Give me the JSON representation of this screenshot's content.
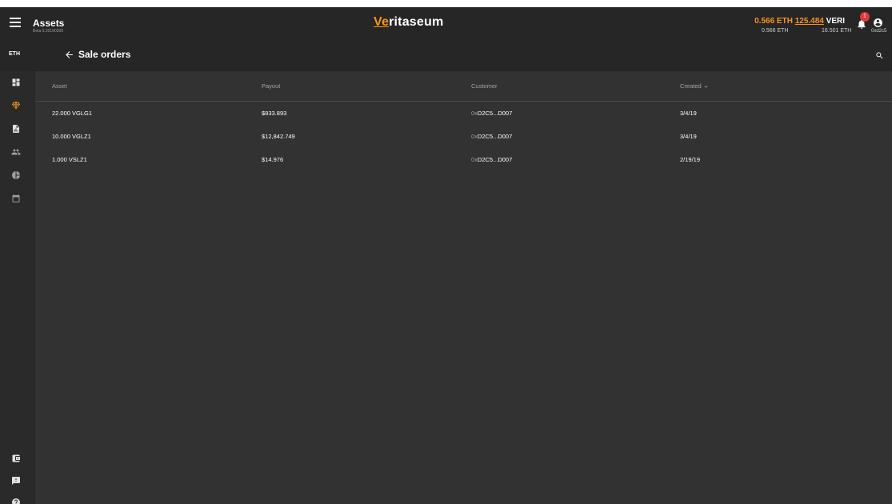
{
  "header": {
    "title": "Assets",
    "version": "Beta 9.20190308",
    "brand_prefix": "Ve",
    "brand_suffix": "ritaseum",
    "balance_eth": "0.566 ETH",
    "balance_veri_value": "125.484",
    "balance_veri_unit": "VERI",
    "sub_eth": "0.566 ETH",
    "sub_veri_eth": "16.501 ETH",
    "notifications_count": "1",
    "account_address": "0xd2c5"
  },
  "subheader": {
    "network": "ETH",
    "page_title": "Sale orders"
  },
  "table": {
    "columns": [
      "Asset",
      "Payout",
      "Customer",
      "Created"
    ],
    "rows": [
      {
        "asset": "22.000 VGLG1",
        "payout": "$833.893",
        "customer_prefix": "0x",
        "customer": "D2C5...D007",
        "created": "3/4/19"
      },
      {
        "asset": "10.000 VGLZ1",
        "payout": "$12,842.749",
        "customer_prefix": "0x",
        "customer": "D2C5...D007",
        "created": "3/4/19"
      },
      {
        "asset": "1.000 VSLZ1",
        "payout": "$14.976",
        "customer_prefix": "0x",
        "customer": "D2C5...D007",
        "created": "2/19/19"
      }
    ]
  },
  "sidebar": {
    "icons": [
      "dashboard-icon",
      "diamond-icon",
      "report-icon",
      "people-icon",
      "pie-chart-icon",
      "calendar-icon"
    ],
    "bottom_icons": [
      "wallet-icon",
      "feedback-icon",
      "help-icon"
    ]
  },
  "colors": {
    "accent": "#f7941d",
    "badge": "#e53935",
    "background": "#323232",
    "header": "#262626"
  }
}
